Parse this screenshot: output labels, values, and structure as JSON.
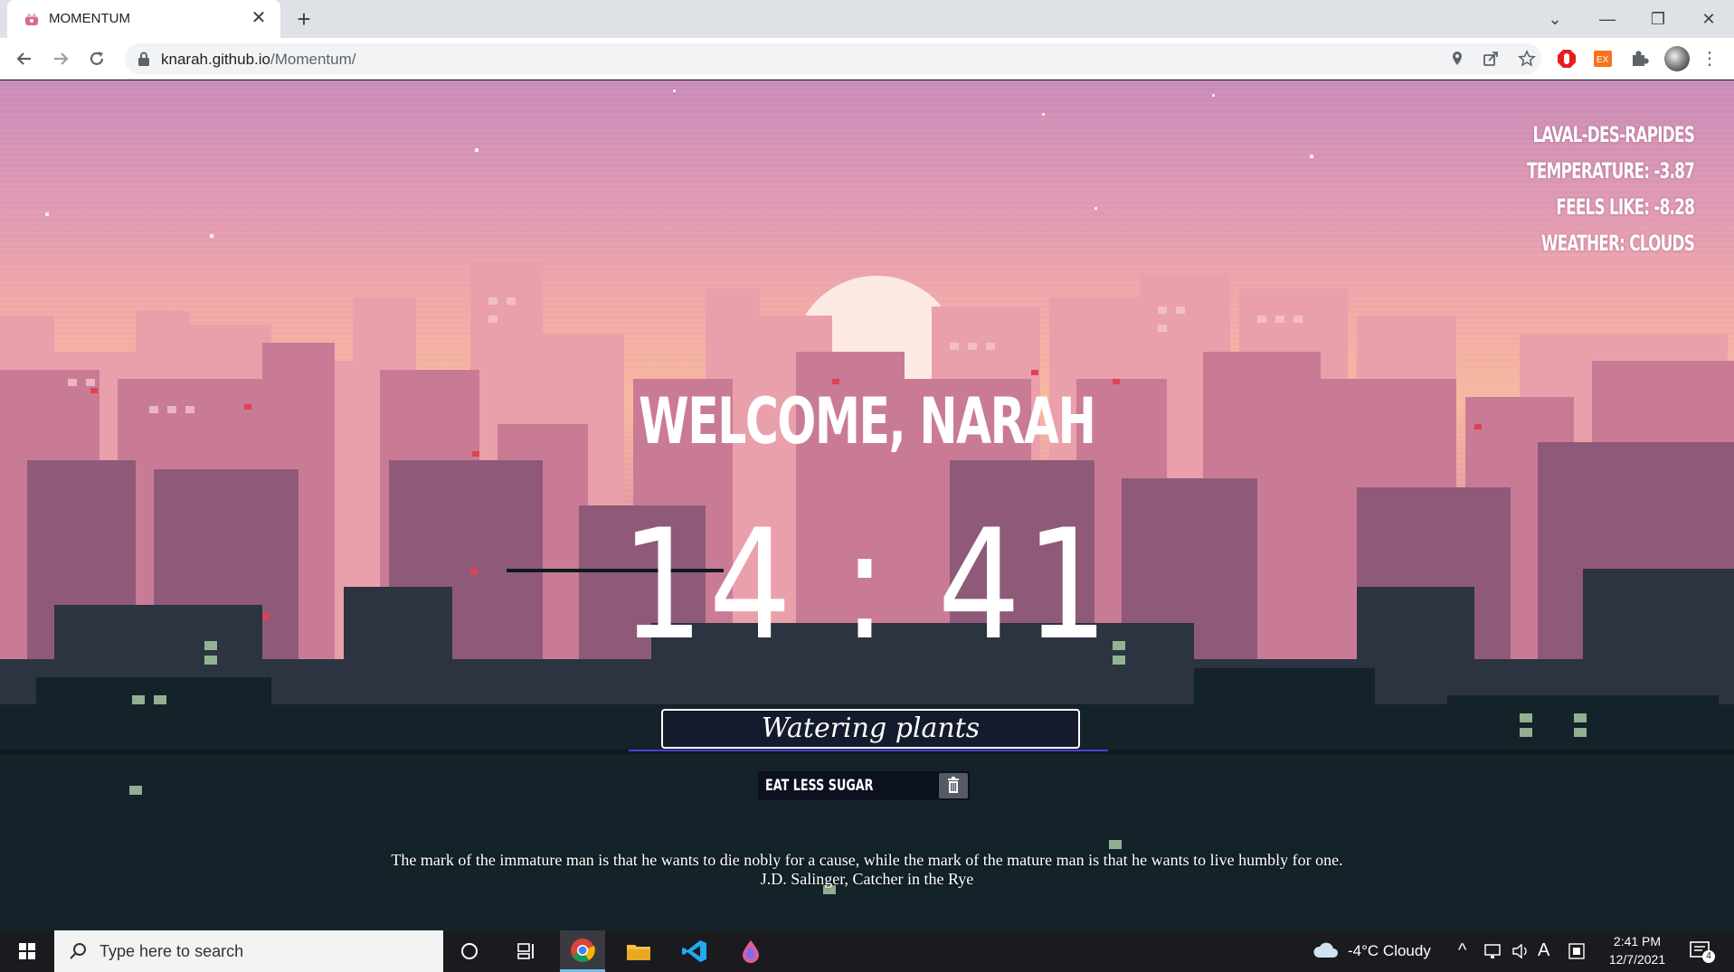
{
  "browser": {
    "tab_title": "MOMENTUM",
    "url_host": "knarah.github.io",
    "url_path": "/Momentum/"
  },
  "weather": {
    "city": "LAVAL-DES-RAPIDES",
    "temperature": "TEMPERATURE: -3.87",
    "feels_like": "FEELS LIKE: -8.28",
    "conditions": "WEATHER: CLOUDS"
  },
  "greeting": "WELCOME, NARAH",
  "clock": "14 : 41",
  "todo": {
    "input_value": "Watering plants",
    "items": [
      {
        "label": "EAT LESS SUGAR"
      }
    ]
  },
  "quote": {
    "text": "The mark of the immature man is that he wants to die nobly for a cause, while the mark of the mature man is that he wants to live humbly for one.",
    "author": "J.D. Salinger, Catcher in the Rye"
  },
  "taskbar": {
    "search_placeholder": "Type here to search",
    "weather": "-4°C  Cloudy",
    "time": "2:41 PM",
    "date": "12/7/2021",
    "notification_count": "4"
  },
  "icons": {
    "tab_favicon": "crown-icon",
    "back": "arrow-left-icon",
    "forward": "arrow-right-icon",
    "reload": "reload-icon",
    "lock": "lock-icon",
    "location": "location-pin-icon",
    "share": "share-icon",
    "bookmark": "star-icon",
    "extensions": "puzzle-icon",
    "trash": "trash-icon"
  },
  "colors": {
    "accent_underline": "#4b3fd6",
    "text": "#ffffff"
  }
}
